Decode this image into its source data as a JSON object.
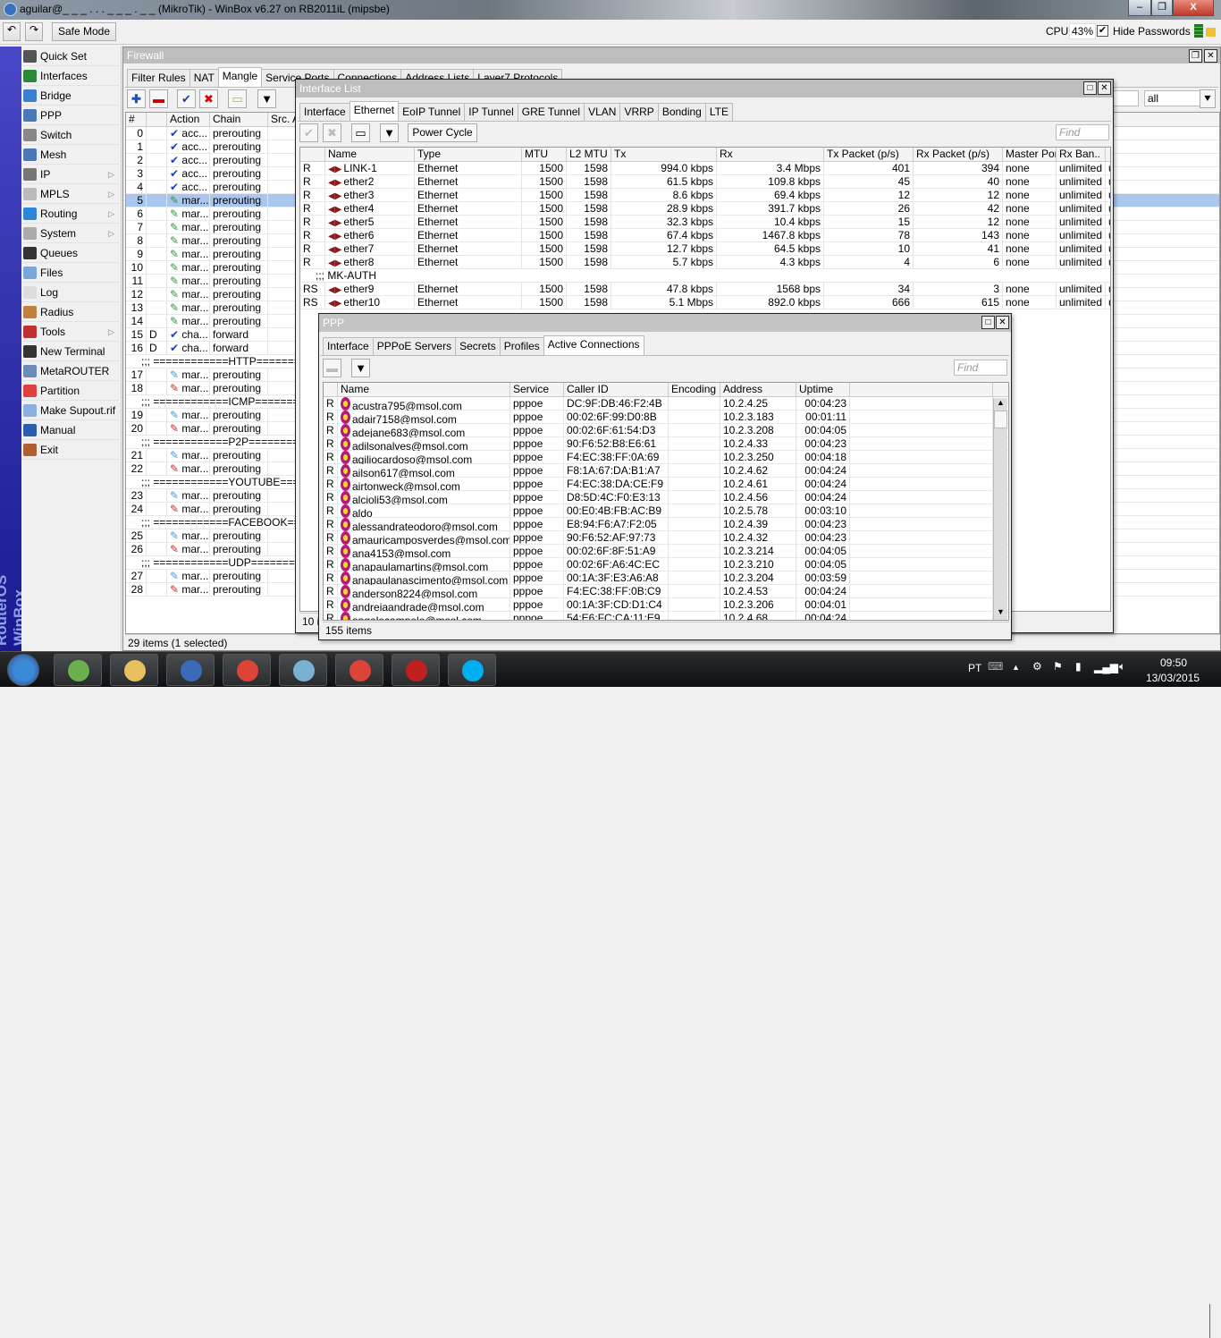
{
  "window": {
    "title": "aguilar@_ _ _ . . . _ _ _ . _ _ (MikroTik) - WinBox v6.27 on RB2011iL (mipsbe)",
    "minimize": "–",
    "maximize": "❐",
    "close": "X"
  },
  "toolbar": {
    "undo": "↶",
    "redo": "↷",
    "safe_mode": "Safe Mode",
    "cpu_label": "CPU:",
    "cpu_value": "43%",
    "hide_passwords": "Hide Passwords",
    "hide_passwords_checked": true
  },
  "brand": "RouterOS WinBox",
  "menu": [
    {
      "label": "Quick Set",
      "color": "#555"
    },
    {
      "label": "Interfaces",
      "color": "#2a8a3a"
    },
    {
      "label": "Bridge",
      "color": "#3a7fd0"
    },
    {
      "label": "PPP",
      "color": "#4a78b8"
    },
    {
      "label": "Switch",
      "color": "#888"
    },
    {
      "label": "Mesh",
      "color": "#4a78b8"
    },
    {
      "label": "IP",
      "color": "#777",
      "sub": true
    },
    {
      "label": "MPLS",
      "color": "#bbb",
      "sub": true
    },
    {
      "label": "Routing",
      "color": "#2e86d8",
      "sub": true
    },
    {
      "label": "System",
      "color": "#aaa",
      "sub": true
    },
    {
      "label": "Queues",
      "color": "#333"
    },
    {
      "label": "Files",
      "color": "#7aa7d8"
    },
    {
      "label": "Log",
      "color": "#ddd"
    },
    {
      "label": "Radius",
      "color": "#c08040"
    },
    {
      "label": "Tools",
      "color": "#c03030",
      "sub": true
    },
    {
      "label": "New Terminal",
      "color": "#333"
    },
    {
      "label": "MetaROUTER",
      "color": "#6a8ab8"
    },
    {
      "label": "Partition",
      "color": "#e04040"
    },
    {
      "label": "Make Supout.rif",
      "color": "#8ab0e0"
    },
    {
      "label": "Manual",
      "color": "#2a5fb0"
    },
    {
      "label": "Exit",
      "color": "#b06030"
    }
  ],
  "firewall": {
    "title": "Firewall",
    "tabs": [
      "Filter Rules",
      "NAT",
      "Mangle",
      "Service Ports",
      "Connections",
      "Address Lists",
      "Layer7 Protocols"
    ],
    "active_tab": "Mangle",
    "filter_value": "all",
    "columns": [
      "#",
      "",
      "Action",
      "Chain",
      "Src. A"
    ],
    "rows": [
      {
        "n": "0",
        "f": "",
        "a": "acc...",
        "c": "prerouting",
        "i": "check"
      },
      {
        "n": "1",
        "f": "",
        "a": "acc...",
        "c": "prerouting",
        "i": "check"
      },
      {
        "n": "2",
        "f": "",
        "a": "acc...",
        "c": "prerouting",
        "i": "check"
      },
      {
        "n": "3",
        "f": "",
        "a": "acc...",
        "c": "prerouting",
        "i": "check"
      },
      {
        "n": "4",
        "f": "",
        "a": "acc...",
        "c": "prerouting",
        "i": "check"
      },
      {
        "n": "5",
        "f": "",
        "a": "mar...",
        "c": "prerouting",
        "i": "green",
        "sel": true
      },
      {
        "n": "6",
        "f": "",
        "a": "mar...",
        "c": "prerouting",
        "i": "green"
      },
      {
        "n": "7",
        "f": "",
        "a": "mar...",
        "c": "prerouting",
        "i": "green"
      },
      {
        "n": "8",
        "f": "",
        "a": "mar...",
        "c": "prerouting",
        "i": "green"
      },
      {
        "n": "9",
        "f": "",
        "a": "mar...",
        "c": "prerouting",
        "i": "green"
      },
      {
        "n": "10",
        "f": "",
        "a": "mar...",
        "c": "prerouting",
        "i": "green"
      },
      {
        "n": "11",
        "f": "",
        "a": "mar...",
        "c": "prerouting",
        "i": "green"
      },
      {
        "n": "12",
        "f": "",
        "a": "mar...",
        "c": "prerouting",
        "i": "green"
      },
      {
        "n": "13",
        "f": "",
        "a": "mar...",
        "c": "prerouting",
        "i": "green"
      },
      {
        "n": "14",
        "f": "",
        "a": "mar...",
        "c": "prerouting",
        "i": "green"
      },
      {
        "n": "15",
        "f": "D",
        "a": "cha...",
        "c": "forward",
        "i": "check"
      },
      {
        "n": "16",
        "f": "D",
        "a": "cha...",
        "c": "forward",
        "i": "check"
      },
      {
        "comment": ";;; ============HTTP============"
      },
      {
        "n": "17",
        "f": "",
        "a": "mar...",
        "c": "prerouting",
        "i": "blue"
      },
      {
        "n": "18",
        "f": "",
        "a": "mar...",
        "c": "prerouting",
        "i": "red"
      },
      {
        "comment": ";;; ============ICMP============"
      },
      {
        "n": "19",
        "f": "",
        "a": "mar...",
        "c": "prerouting",
        "i": "blue"
      },
      {
        "n": "20",
        "f": "",
        "a": "mar...",
        "c": "prerouting",
        "i": "red"
      },
      {
        "comment": ";;; ============P2P============"
      },
      {
        "n": "21",
        "f": "",
        "a": "mar...",
        "c": "prerouting",
        "i": "blue"
      },
      {
        "n": "22",
        "f": "",
        "a": "mar...",
        "c": "prerouting",
        "i": "red"
      },
      {
        "comment": ";;; ============YOUTUBE============"
      },
      {
        "n": "23",
        "f": "",
        "a": "mar...",
        "c": "prerouting",
        "i": "blue"
      },
      {
        "n": "24",
        "f": "",
        "a": "mar...",
        "c": "prerouting",
        "i": "red"
      },
      {
        "comment": ";;; ============FACEBOOK============"
      },
      {
        "n": "25",
        "f": "",
        "a": "mar...",
        "c": "prerouting",
        "i": "blue"
      },
      {
        "n": "26",
        "f": "",
        "a": "mar...",
        "c": "prerouting",
        "i": "red"
      },
      {
        "comment": ";;; ============UDP============"
      },
      {
        "n": "27",
        "f": "",
        "a": "mar...",
        "c": "prerouting",
        "i": "blue"
      },
      {
        "n": "28",
        "f": "",
        "a": "mar...",
        "c": "prerouting",
        "i": "red"
      }
    ],
    "status": "29 items (1 selected)"
  },
  "interface_list": {
    "title": "Interface List",
    "tabs": [
      "Interface",
      "Ethernet",
      "EoIP Tunnel",
      "IP Tunnel",
      "GRE Tunnel",
      "VLAN",
      "VRRP",
      "Bonding",
      "LTE"
    ],
    "active_tab": "Ethernet",
    "power_cycle": "Power Cycle",
    "find_placeholder": "Find",
    "columns": [
      "",
      "Name",
      "Type",
      "MTU",
      "L2 MTU",
      "Tx",
      "Rx",
      "Tx Packet (p/s)",
      "Rx Packet (p/s)",
      "Master Port",
      "Rx Ban..",
      ""
    ],
    "rows": [
      {
        "f": "R",
        "name": "LINK-1",
        "type": "Ethernet",
        "mtu": "1500",
        "l2": "1598",
        "tx": "994.0 kbps",
        "rx": "3.4 Mbps",
        "txp": "401",
        "rxp": "394",
        "mp": "none",
        "rb": "unlimited",
        "x": "u"
      },
      {
        "f": "R",
        "name": "ether2",
        "type": "Ethernet",
        "mtu": "1500",
        "l2": "1598",
        "tx": "61.5 kbps",
        "rx": "109.8 kbps",
        "txp": "45",
        "rxp": "40",
        "mp": "none",
        "rb": "unlimited",
        "x": "u"
      },
      {
        "f": "R",
        "name": "ether3",
        "type": "Ethernet",
        "mtu": "1500",
        "l2": "1598",
        "tx": "8.6 kbps",
        "rx": "69.4 kbps",
        "txp": "12",
        "rxp": "12",
        "mp": "none",
        "rb": "unlimited",
        "x": "u"
      },
      {
        "f": "R",
        "name": "ether4",
        "type": "Ethernet",
        "mtu": "1500",
        "l2": "1598",
        "tx": "28.9 kbps",
        "rx": "391.7 kbps",
        "txp": "26",
        "rxp": "42",
        "mp": "none",
        "rb": "unlimited",
        "x": "u"
      },
      {
        "f": "R",
        "name": "ether5",
        "type": "Ethernet",
        "mtu": "1500",
        "l2": "1598",
        "tx": "32.3 kbps",
        "rx": "10.4 kbps",
        "txp": "15",
        "rxp": "12",
        "mp": "none",
        "rb": "unlimited",
        "x": "u"
      },
      {
        "f": "R",
        "name": "ether6",
        "type": "Ethernet",
        "mtu": "1500",
        "l2": "1598",
        "tx": "67.4 kbps",
        "rx": "1467.8 kbps",
        "txp": "78",
        "rxp": "143",
        "mp": "none",
        "rb": "unlimited",
        "x": "u"
      },
      {
        "f": "R",
        "name": "ether7",
        "type": "Ethernet",
        "mtu": "1500",
        "l2": "1598",
        "tx": "12.7 kbps",
        "rx": "64.5 kbps",
        "txp": "10",
        "rxp": "41",
        "mp": "none",
        "rb": "unlimited",
        "x": "u"
      },
      {
        "f": "R",
        "name": "ether8",
        "type": "Ethernet",
        "mtu": "1500",
        "l2": "1598",
        "tx": "5.7 kbps",
        "rx": "4.3 kbps",
        "txp": "4",
        "rxp": "6",
        "mp": "none",
        "rb": "unlimited",
        "x": "u"
      },
      {
        "comment": ";;; MK-AUTH"
      },
      {
        "f": "RS",
        "name": "ether9",
        "type": "Ethernet",
        "mtu": "1500",
        "l2": "1598",
        "tx": "47.8 kbps",
        "rx": "1568 bps",
        "txp": "34",
        "rxp": "3",
        "mp": "none",
        "rb": "unlimited",
        "x": "u"
      },
      {
        "f": "RS",
        "name": "ether10",
        "type": "Ethernet",
        "mtu": "1500",
        "l2": "1598",
        "tx": "5.1 Mbps",
        "rx": "892.0 kbps",
        "txp": "666",
        "rxp": "615",
        "mp": "none",
        "rb": "unlimited",
        "x": "u"
      }
    ],
    "status": "10 it"
  },
  "ppp": {
    "title": "PPP",
    "tabs": [
      "Interface",
      "PPPoE Servers",
      "Secrets",
      "Profiles",
      "Active Connections"
    ],
    "active_tab": "Active Connections",
    "find_placeholder": "Find",
    "columns": [
      "",
      "Name",
      "Service",
      "Caller ID",
      "Encoding",
      "Address",
      "Uptime",
      ""
    ],
    "rows": [
      {
        "f": "R",
        "name": "acustra795@msol.com",
        "svc": "pppoe",
        "cid": "DC:9F:DB:46:F2:4B",
        "enc": "",
        "addr": "10.2.4.25",
        "up": "00:04:23"
      },
      {
        "f": "R",
        "name": "adair7158@msol.com",
        "svc": "pppoe",
        "cid": "00:02:6F:99:D0:8B",
        "enc": "",
        "addr": "10.2.3.183",
        "up": "00:01:11"
      },
      {
        "f": "R",
        "name": "adejane683@msol.com",
        "svc": "pppoe",
        "cid": "00:02:6F:61:54:D3",
        "enc": "",
        "addr": "10.2.3.208",
        "up": "00:04:05"
      },
      {
        "f": "R",
        "name": "adilsonalves@msol.com",
        "svc": "pppoe",
        "cid": "90:F6:52:B8:E6:61",
        "enc": "",
        "addr": "10.2.4.33",
        "up": "00:04:23"
      },
      {
        "f": "R",
        "name": "agiliocardoso@msol.com",
        "svc": "pppoe",
        "cid": "F4:EC:38:FF:0A:69",
        "enc": "",
        "addr": "10.2.3.250",
        "up": "00:04:18"
      },
      {
        "f": "R",
        "name": "ailson617@msol.com",
        "svc": "pppoe",
        "cid": "F8:1A:67:DA:B1:A7",
        "enc": "",
        "addr": "10.2.4.62",
        "up": "00:04:24"
      },
      {
        "f": "R",
        "name": "airtonweck@msol.com",
        "svc": "pppoe",
        "cid": "F4:EC:38:DA:CE:F9",
        "enc": "",
        "addr": "10.2.4.61",
        "up": "00:04:24"
      },
      {
        "f": "R",
        "name": "alcioli53@msol.com",
        "svc": "pppoe",
        "cid": "D8:5D:4C:F0:E3:13",
        "enc": "",
        "addr": "10.2.4.56",
        "up": "00:04:24"
      },
      {
        "f": "R",
        "name": "aldo",
        "svc": "pppoe",
        "cid": "00:E0:4B:FB:AC:B9",
        "enc": "",
        "addr": "10.2.5.78",
        "up": "00:03:10"
      },
      {
        "f": "R",
        "name": "alessandrateodoro@msol.com",
        "svc": "pppoe",
        "cid": "E8:94:F6:A7:F2:05",
        "enc": "",
        "addr": "10.2.4.39",
        "up": "00:04:23"
      },
      {
        "f": "R",
        "name": "amauricamposverdes@msol.com",
        "svc": "pppoe",
        "cid": "90:F6:52:AF:97:73",
        "enc": "",
        "addr": "10.2.4.32",
        "up": "00:04:23"
      },
      {
        "f": "R",
        "name": "ana4153@msol.com",
        "svc": "pppoe",
        "cid": "00:02:6F:8F:51:A9",
        "enc": "",
        "addr": "10.2.3.214",
        "up": "00:04:05"
      },
      {
        "f": "R",
        "name": "anapaulamartins@msol.com",
        "svc": "pppoe",
        "cid": "00:02:6F:A6:4C:EC",
        "enc": "",
        "addr": "10.2.3.210",
        "up": "00:04:05"
      },
      {
        "f": "R",
        "name": "anapaulanascimento@msol.com",
        "svc": "pppoe",
        "cid": "00:1A:3F:E3:A6:A8",
        "enc": "",
        "addr": "10.2.3.204",
        "up": "00:03:59"
      },
      {
        "f": "R",
        "name": "anderson8224@msol.com",
        "svc": "pppoe",
        "cid": "F4:EC:38:FF:0B:C9",
        "enc": "",
        "addr": "10.2.4.53",
        "up": "00:04:24"
      },
      {
        "f": "R",
        "name": "andreiaandrade@msol.com",
        "svc": "pppoe",
        "cid": "00:1A:3F:CD:D1:C4",
        "enc": "",
        "addr": "10.2.3.206",
        "up": "00:04:01"
      },
      {
        "f": "R",
        "name": "angelocampelo@msol.com",
        "svc": "pppoe",
        "cid": "54:E6:FC:CA:11:E9",
        "enc": "",
        "addr": "10.2.4.68",
        "up": "00:04:24"
      }
    ],
    "status": "155 items"
  },
  "taskbar": {
    "apps": [
      {
        "name": "start",
        "color": "#3a8ad8"
      },
      {
        "name": "vmware",
        "color": "#6ab04c"
      },
      {
        "name": "explorer",
        "color": "#e8c060"
      },
      {
        "name": "winbox",
        "color": "#3a6ab8"
      },
      {
        "name": "chrome",
        "color": "#db4437"
      },
      {
        "name": "notepad",
        "color": "#7ab0d0"
      },
      {
        "name": "chrome-2",
        "color": "#db4437"
      },
      {
        "name": "app-red",
        "color": "#c02020"
      },
      {
        "name": "skype",
        "color": "#00aff0"
      }
    ],
    "lang": "PT",
    "time": "09:50",
    "date": "13/03/2015"
  }
}
